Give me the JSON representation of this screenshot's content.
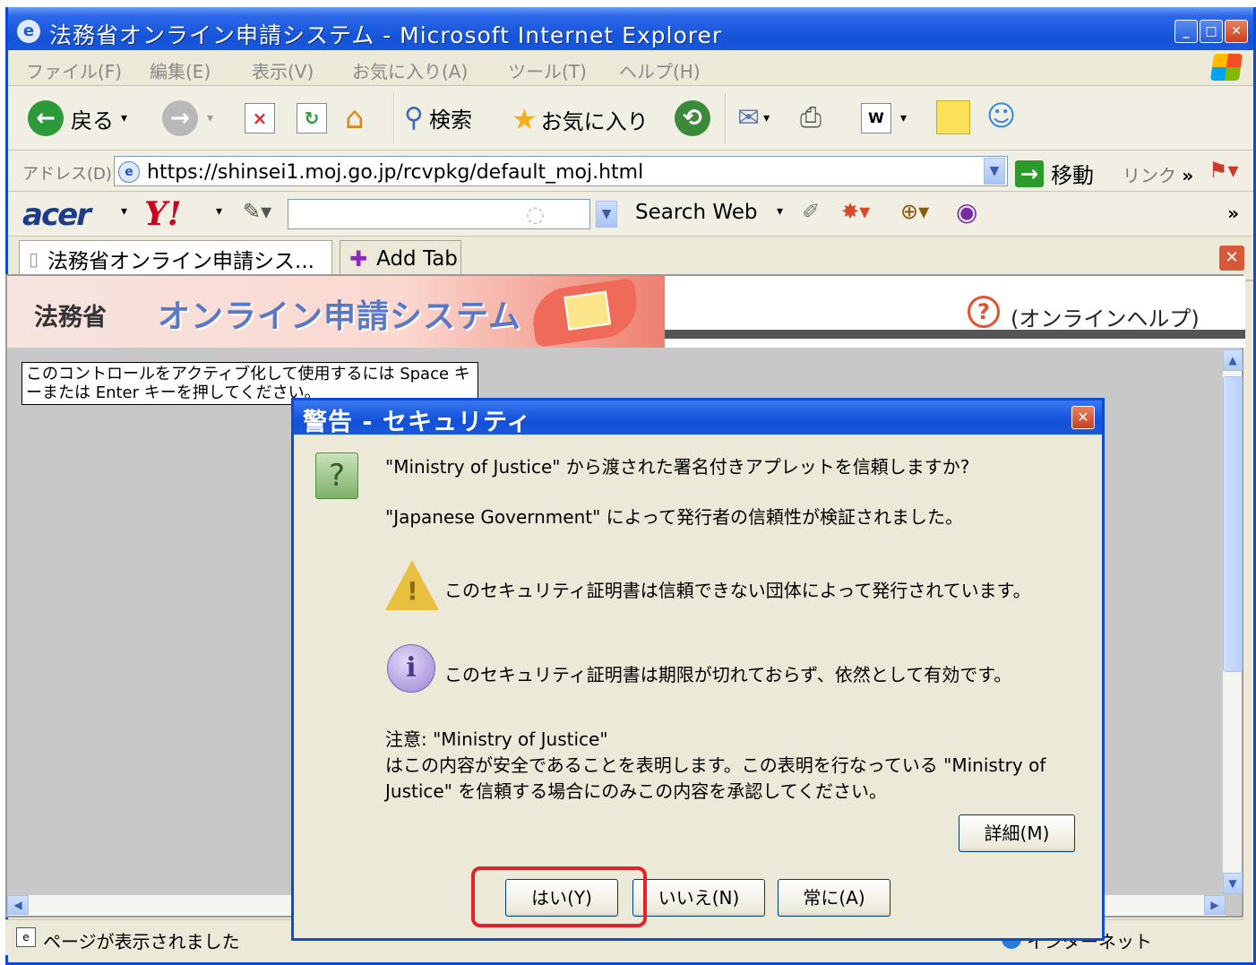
{
  "window": {
    "title": "法務省オンライン申請システム - Microsoft Internet Explorer"
  },
  "menubar": {
    "items": [
      "ファイル(F)",
      "編集(E)",
      "表示(V)",
      "お気に入り(A)",
      "ツール(T)",
      "ヘルプ(H)"
    ]
  },
  "toolbar": {
    "back_label": "戻る",
    "search_label": "検索",
    "favorites_label": "お気に入り"
  },
  "address": {
    "label": "アドレス(D)",
    "url": "https://shinsei1.moj.go.jp/rcvpkg/default_moj.html",
    "go_label": "移動",
    "links_label": "リンク"
  },
  "acerbar": {
    "brand": "acer",
    "yahoo": "Y!",
    "search_web": "Search Web"
  },
  "tabs": {
    "active_tab": "法務省オンライン申請シス...",
    "add_tab": "Add Tab"
  },
  "page": {
    "ministry": "法務省",
    "system_name": "オンライン申請システム",
    "help_link": "(オンラインヘルプ)",
    "tooltip": "このコントロールをアクティブ化して使用するには Space キーまたは Enter キーを押してください。"
  },
  "dialog": {
    "title": "警告 - セキュリティ",
    "question": "\"Ministry of Justice\" から渡された署名付きアプレットを信頼しますか?",
    "verified": "\"Japanese Government\" によって発行者の信頼性が検証されました。",
    "warning": "このセキュリティ証明書は信頼できない団体によって発行されています。",
    "info": "このセキュリティ証明書は期限が切れておらず、依然として有効です。",
    "note_line1": "注意: \"Ministry of Justice\"",
    "note_line2": "はこの内容が安全であることを表明します。この表明を行なっている \"Ministry of",
    "note_line3": "Justice\" を信頼する場合にのみこの内容を承認してください。",
    "details_button": "詳細(M)",
    "yes_button": "はい(Y)",
    "no_button": "いいえ(N)",
    "always_button": "常に(A)"
  },
  "status": {
    "text": "ページが表示されました",
    "zone": "インターネット"
  }
}
